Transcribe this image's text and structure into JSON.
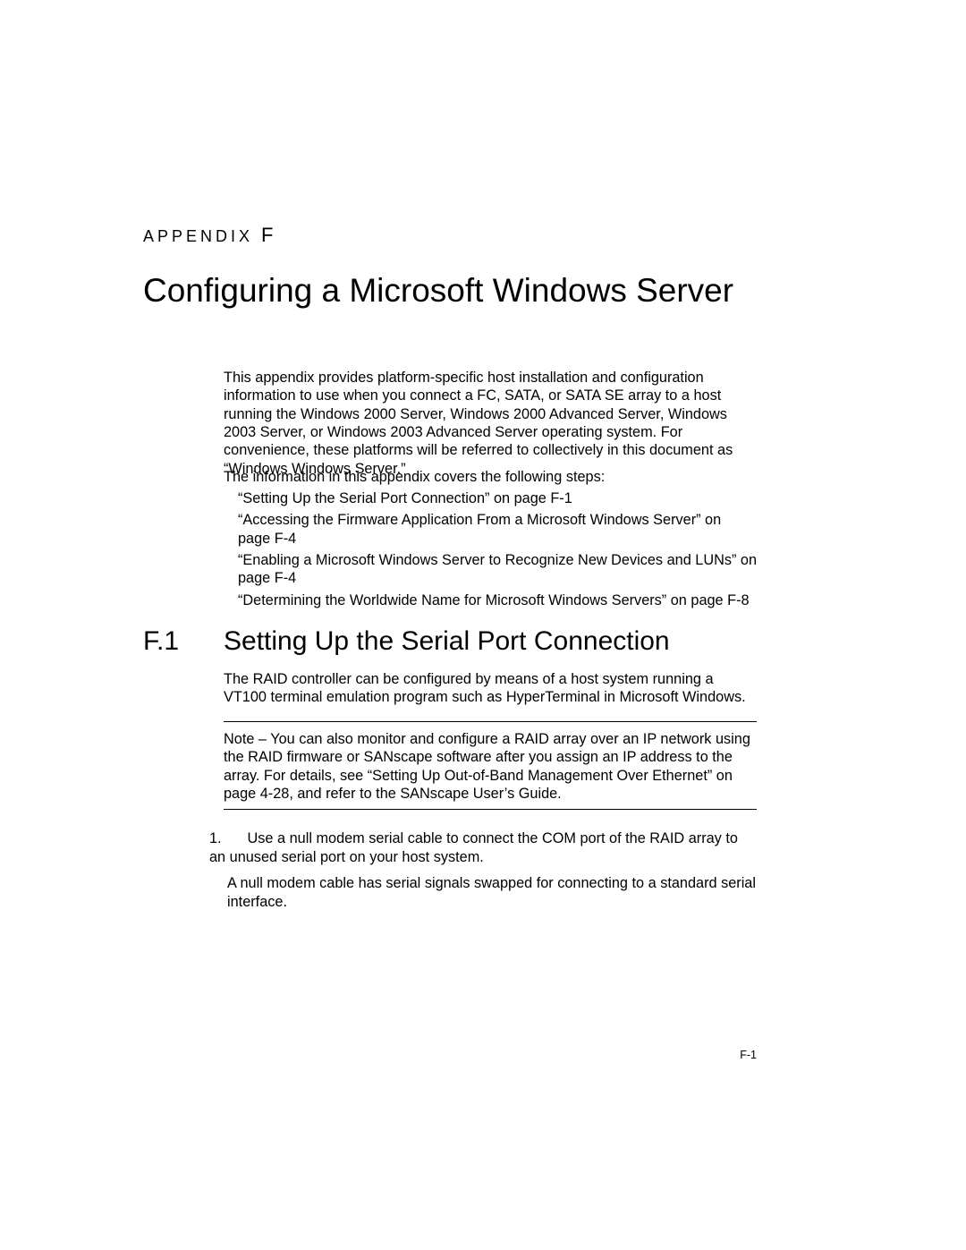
{
  "appendix": {
    "prefix": "APPENDIX",
    "letter": "F"
  },
  "chapter_title": "Configuring a Microsoft Windows Server",
  "intro": "This appendix provides platform-specific host installation and configuration information to use when you connect a FC, SATA, or SATA SE array to a host running the Windows 2000 Server, Windows 2000 Advanced Server, Windows 2003 Server, or Windows 2003 Advanced Server operating system. For convenience, these platforms will be referred to collectively in this document as “Windows Windows Server.”",
  "steps_lead": "The information in this appendix covers the following steps:",
  "bullets": [
    "“Setting Up the Serial Port Connection” on page F-1",
    "“Accessing the Firmware Application From a Microsoft Windows Server” on page F-4",
    "“Enabling a Microsoft Windows Server to Recognize New Devices and LUNs” on page F-4",
    "“Determining the Worldwide Name for Microsoft Windows Servers” on page F-8"
  ],
  "section": {
    "number": "F.1",
    "title": "Setting Up the Serial Port Connection"
  },
  "f1_para1": "The RAID controller can be configured by means of a host system running a VT100 terminal emulation program such as HyperTerminal in Microsoft Windows.",
  "note": "Note – You can also monitor and configure a RAID array over an IP network using the RAID firmware or SANscape software after you assign an IP address to the array. For details, see “Setting Up Out-of-Band Management Over Ethernet” on page 4-28, and refer to the SANscape User’s Guide.",
  "step1": {
    "num": "1.",
    "text": "Use a null modem serial cable to connect the COM port of the RAID array to an unused serial port on your host system.",
    "sub": "A null modem cable has serial signals swapped for connecting to a standard serial interface."
  },
  "folio": "F-1"
}
